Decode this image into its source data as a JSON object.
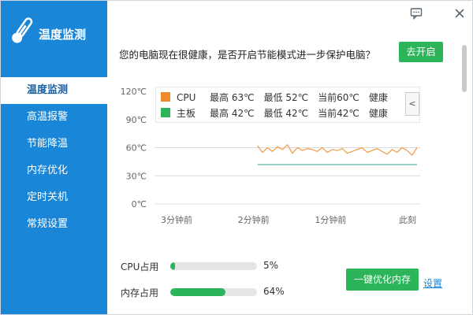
{
  "app": {
    "title": "温度监测"
  },
  "titlebar": {
    "feedback_icon": "feedback-icon",
    "close_icon": "close-icon"
  },
  "sidebar": {
    "items": [
      {
        "label": "温度监测",
        "active": true
      },
      {
        "label": "高温报警",
        "active": false
      },
      {
        "label": "节能降温",
        "active": false
      },
      {
        "label": "内存优化",
        "active": false
      },
      {
        "label": "定时关机",
        "active": false
      },
      {
        "label": "常规设置",
        "active": false
      }
    ]
  },
  "header": {
    "message": "您的电脑现在很健康，是否开启节能模式进一步保护电脑？",
    "button_label": "去开启"
  },
  "chart_data": {
    "type": "line",
    "y_ticks": [
      "120℃",
      "90℃",
      "60℃",
      "30℃",
      "0℃"
    ],
    "x_ticks": [
      "3分钟前",
      "2分钟前",
      "1分钟前",
      "此刻"
    ],
    "ylim": [
      0,
      120
    ],
    "series": [
      {
        "name": "CPU",
        "color": "#f0a050",
        "values": [
          62,
          55,
          60,
          56,
          61,
          58,
          63,
          54,
          60,
          57,
          59,
          58,
          56,
          60,
          55,
          58,
          57,
          59,
          54,
          56,
          58,
          60,
          55,
          57,
          59,
          56,
          53,
          58,
          55,
          60,
          57,
          52,
          60
        ]
      },
      {
        "name": "主板",
        "color": "#5fb8a8",
        "values": [
          42,
          42,
          42,
          42,
          42,
          42,
          42,
          42,
          42,
          42,
          42,
          42,
          42,
          42,
          42,
          42,
          42,
          42,
          42,
          42,
          42,
          42,
          42,
          42,
          42,
          42,
          42,
          42,
          42,
          42,
          42,
          42,
          42
        ]
      }
    ],
    "legend": [
      {
        "name": "CPU",
        "swatch": "#f0882e",
        "max": "最高 63℃",
        "min": "最低 52℃",
        "current": "当前60℃",
        "status": "健康"
      },
      {
        "name": "主板",
        "swatch": "#2cb45a",
        "max": "最高 42℃",
        "min": "最低 42℃",
        "current": "当前42℃",
        "status": "健康"
      }
    ],
    "legend_arrow": "<",
    "legend_placement": "top",
    "grid": true
  },
  "usage": {
    "cpu": {
      "label": "CPU占用",
      "value_text": "5%",
      "percent": 5
    },
    "mem": {
      "label": "内存占用",
      "value_text": "64%",
      "percent": 64
    }
  },
  "actions": {
    "optimize_label": "一键优化内存",
    "settings_label": "设置"
  },
  "colors": {
    "sidebar": "#1a86d8",
    "accent_green": "#2cb45a"
  }
}
